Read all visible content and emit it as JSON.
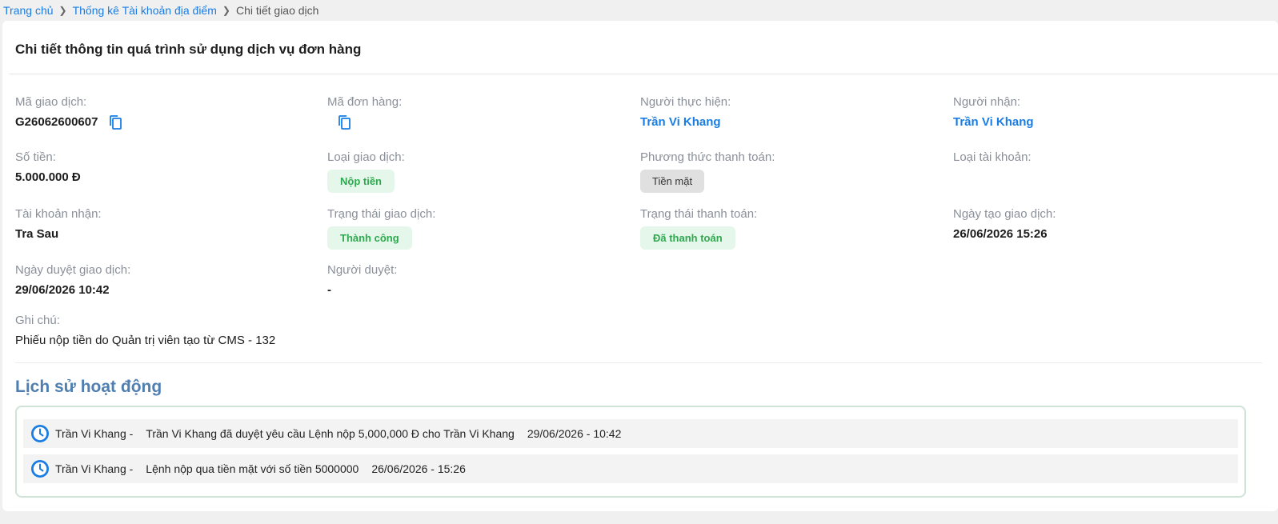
{
  "breadcrumb": {
    "home": "Trang chủ",
    "stats": "Thống kê Tài khoản địa điểm",
    "current": "Chi tiết giao dịch"
  },
  "card": {
    "title": "Chi tiết thông tin quá trình sử dụng dịch vụ đơn hàng"
  },
  "fields": {
    "transaction_id": {
      "label": "Mã giao dịch:",
      "value": "G26062600607"
    },
    "order_id": {
      "label": "Mã đơn hàng:",
      "value": ""
    },
    "performer": {
      "label": "Người thực hiện:",
      "value": "Trần Vi Khang"
    },
    "receiver": {
      "label": "Người nhận:",
      "value": "Trần Vi Khang"
    },
    "amount": {
      "label": "Số tiền:",
      "value": "5.000.000 Đ"
    },
    "transaction_type": {
      "label": "Loại giao dịch:",
      "value": "Nộp tiền"
    },
    "payment_method": {
      "label": "Phương thức thanh toán:",
      "value": "Tiền mặt"
    },
    "account_type": {
      "label": "Loại tài khoản:",
      "value": ""
    },
    "receiving_account": {
      "label": "Tài khoản nhận:",
      "value": "Tra Sau"
    },
    "transaction_status": {
      "label": "Trạng thái giao dịch:",
      "value": "Thành công"
    },
    "payment_status": {
      "label": "Trạng thái thanh toán:",
      "value": "Đã thanh toán"
    },
    "created_date": {
      "label": "Ngày tạo giao dịch:",
      "value": "26/06/2026 15:26"
    },
    "approved_date": {
      "label": "Ngày duyệt giao dịch:",
      "value": "29/06/2026 10:42"
    },
    "approver": {
      "label": "Người duyệt:",
      "value": "-"
    },
    "note": {
      "label": "Ghi chú:",
      "value": "Phiếu nộp tiền do Quản trị viên tạo từ CMS - 132"
    }
  },
  "history": {
    "title": "Lịch sử hoạt động",
    "items": [
      {
        "actor": "Trần Vi Khang -",
        "message": "Trần Vi Khang đã duyệt yêu cầu Lệnh nộp 5,000,000 Đ cho Trần Vi Khang",
        "time": "29/06/2026 - 10:42",
        "icon": "clock-icon"
      },
      {
        "actor": "Trần Vi Khang -",
        "message": "Lệnh nộp qua tiền mặt với số tiền 5000000",
        "time": "26/06/2026 - 15:26",
        "icon": "clock-icon"
      }
    ]
  },
  "colors": {
    "link": "#1a7de3",
    "success_bg": "#e5f7ea",
    "success_text": "#2fa84f",
    "history_title": "#4e7fb0",
    "clock": "#1a7de3"
  }
}
